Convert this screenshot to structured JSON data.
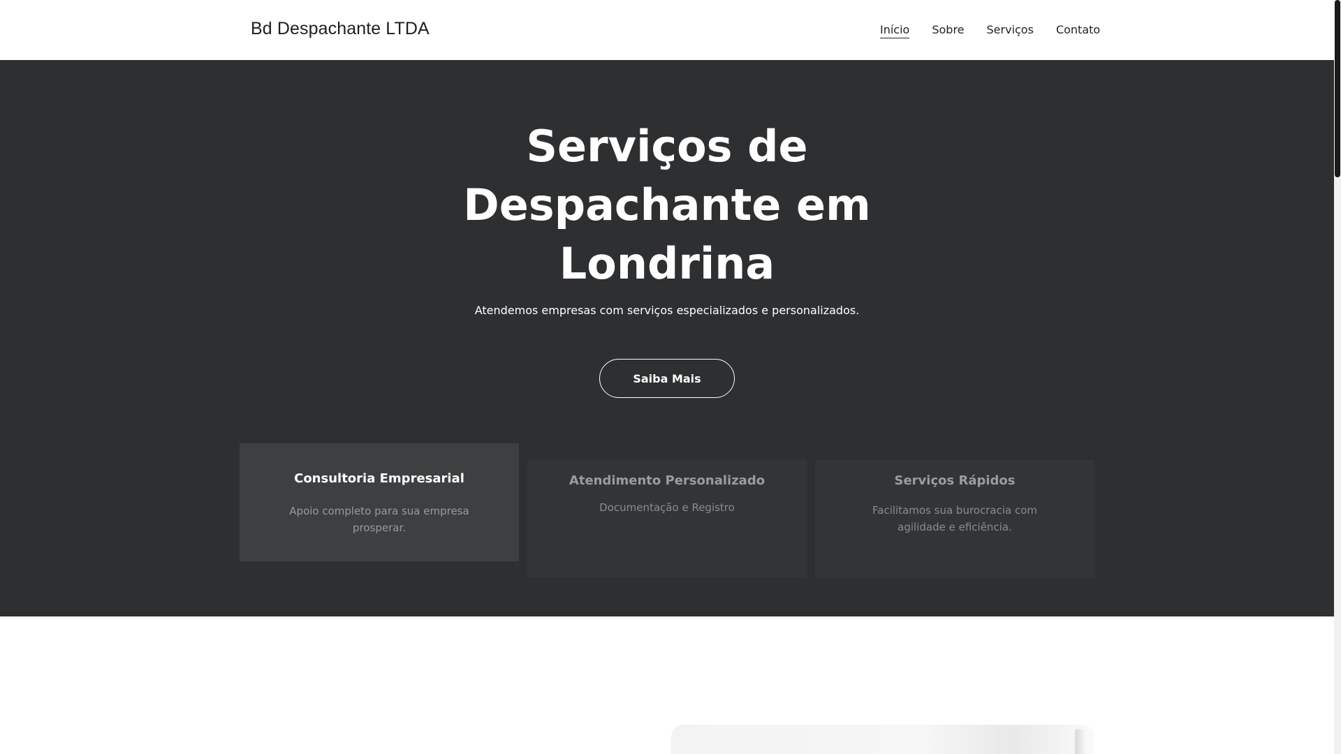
{
  "header": {
    "brand": "Bd Despachante LTDA",
    "nav": [
      {
        "label": "Início",
        "active": true
      },
      {
        "label": "Sobre",
        "active": false
      },
      {
        "label": "Serviços",
        "active": false
      },
      {
        "label": "Contato",
        "active": false
      }
    ]
  },
  "hero": {
    "title_lines": [
      "Serviços de",
      "Despachante em",
      "Londrina"
    ],
    "subtitle": "Atendemos empresas com serviços especializados e personalizados.",
    "cta_label": "Saiba Mais",
    "background_color": "#2e2f31"
  },
  "cards": [
    {
      "title": "Consultoria Empresarial",
      "text": "Apoio completo para sua empresa prosperar."
    },
    {
      "title": "Atendimento Personalizado",
      "text": "Documentação e Registro"
    },
    {
      "title": "Serviços Rápidos",
      "text": "Facilitamos sua burocracia com agilidade e eficiência."
    }
  ]
}
